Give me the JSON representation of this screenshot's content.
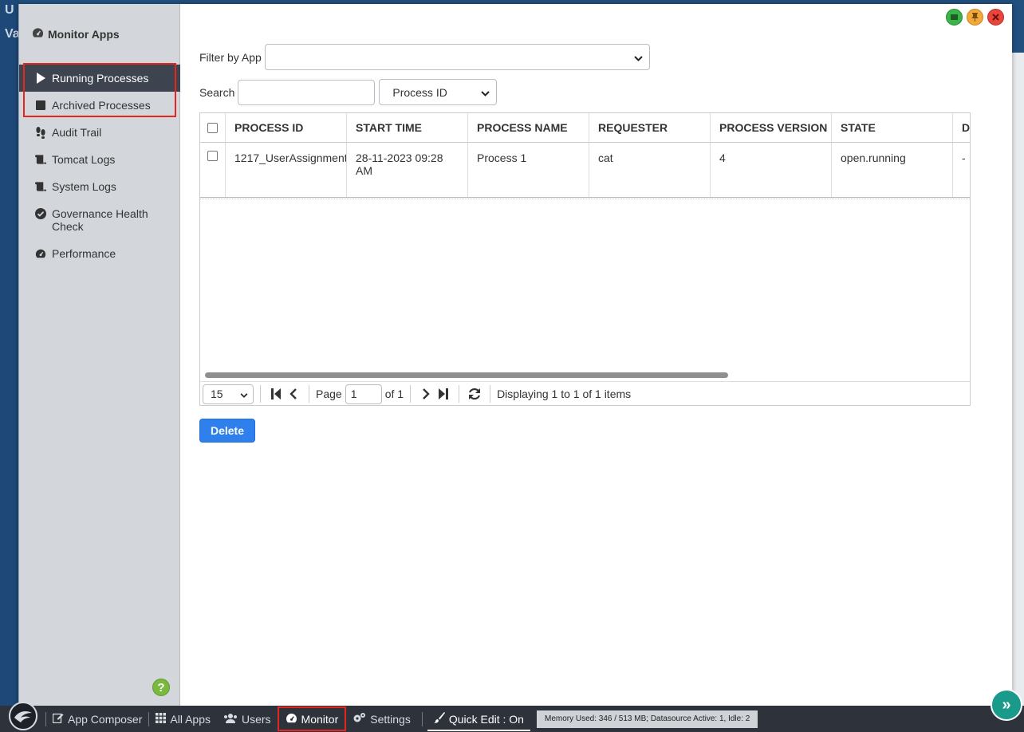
{
  "background": {
    "left_text_1": "U",
    "left_text_2": "Va"
  },
  "sidebar": {
    "title": "Monitor Apps",
    "items": [
      {
        "label": "Running Processes",
        "icon": "play-icon",
        "active": true
      },
      {
        "label": "Archived Processes",
        "icon": "stop-icon",
        "active": false
      },
      {
        "label": "Audit Trail",
        "icon": "footprints-icon",
        "active": false
      },
      {
        "label": "Tomcat Logs",
        "icon": "scroll-icon",
        "active": false
      },
      {
        "label": "System Logs",
        "icon": "scroll-icon",
        "active": false
      },
      {
        "label": "Governance Health Check",
        "icon": "check-circle-icon",
        "active": false
      },
      {
        "label": "Performance",
        "icon": "gauge-icon",
        "active": false
      }
    ]
  },
  "filters": {
    "filter_label": "Filter by App",
    "filter_value": "",
    "search_label": "Search",
    "search_value": "",
    "search_field": "Process ID"
  },
  "table": {
    "columns": [
      "PROCESS ID",
      "START TIME",
      "PROCESS NAME",
      "REQUESTER",
      "PROCESS VERSION",
      "STATE",
      "D"
    ],
    "rows": [
      {
        "process_id": "1217_UserAssignment",
        "start_time": "28-11-2023 09:28 AM",
        "process_name": "Process 1",
        "requester": "cat",
        "process_version": "4",
        "state": "open.running",
        "extra": "-"
      }
    ]
  },
  "pager": {
    "page_size": "15",
    "page_label": "Page",
    "page_value": "1",
    "of_label": "of 1",
    "display_text": "Displaying 1 to 1 of 1 items"
  },
  "actions": {
    "delete_label": "Delete"
  },
  "bottom_bar": {
    "app_composer": "App Composer",
    "all_apps": "All Apps",
    "users": "Users",
    "monitor": "Monitor",
    "settings": "Settings",
    "quick_edit": "Quick Edit : On",
    "memory": "Memory Used: 346 / 513 MB; Datasource Active: 1, Idle: 2"
  },
  "colors": {
    "accent": "#2f80ed",
    "sidebar_active": "#3d4450",
    "highlight": "#e3271f",
    "bottom_bar": "#2e323a"
  }
}
